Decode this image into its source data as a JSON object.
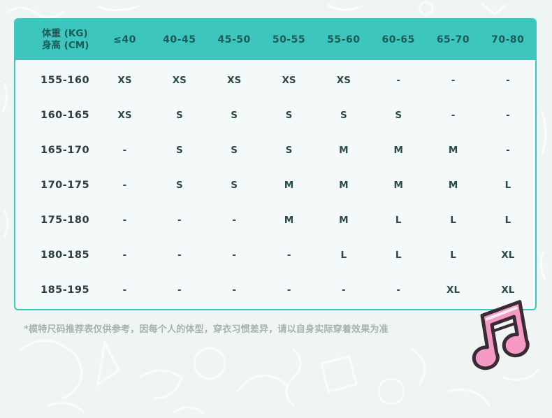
{
  "table": {
    "corner_top": "体重 (KG)",
    "corner_bottom": "身高 (CM)",
    "weight_headers": [
      "≤40",
      "40-45",
      "45-50",
      "50-55",
      "55-60",
      "60-65",
      "65-70",
      "70-80"
    ],
    "rows": [
      {
        "height": "155-160",
        "sizes": [
          "XS",
          "XS",
          "XS",
          "XS",
          "XS",
          "-",
          "-",
          "-"
        ]
      },
      {
        "height": "160-165",
        "sizes": [
          "XS",
          "S",
          "S",
          "S",
          "S",
          "S",
          "-",
          "-"
        ]
      },
      {
        "height": "165-170",
        "sizes": [
          "-",
          "S",
          "S",
          "S",
          "M",
          "M",
          "M",
          "-"
        ]
      },
      {
        "height": "170-175",
        "sizes": [
          "-",
          "S",
          "S",
          "M",
          "M",
          "M",
          "M",
          "L"
        ]
      },
      {
        "height": "175-180",
        "sizes": [
          "-",
          "-",
          "-",
          "M",
          "M",
          "L",
          "L",
          "L"
        ]
      },
      {
        "height": "180-185",
        "sizes": [
          "-",
          "-",
          "-",
          "-",
          "L",
          "L",
          "L",
          "XL"
        ]
      },
      {
        "height": "185-195",
        "sizes": [
          "-",
          "-",
          "-",
          "-",
          "-",
          "-",
          "XL",
          "XL"
        ]
      }
    ]
  },
  "footnote": "*模特尺码推荐表仅供参考，因每个人的体型，穿衣习惯差异，请以自身实际穿着效果为准",
  "colors": {
    "header": "#3cc6be",
    "border": "#3cc6be",
    "background": "#eef5f3",
    "logo_pink": "#f59ac4",
    "logo_dark": "#3a2a33"
  },
  "logo_icon": "music-note-logo-icon"
}
